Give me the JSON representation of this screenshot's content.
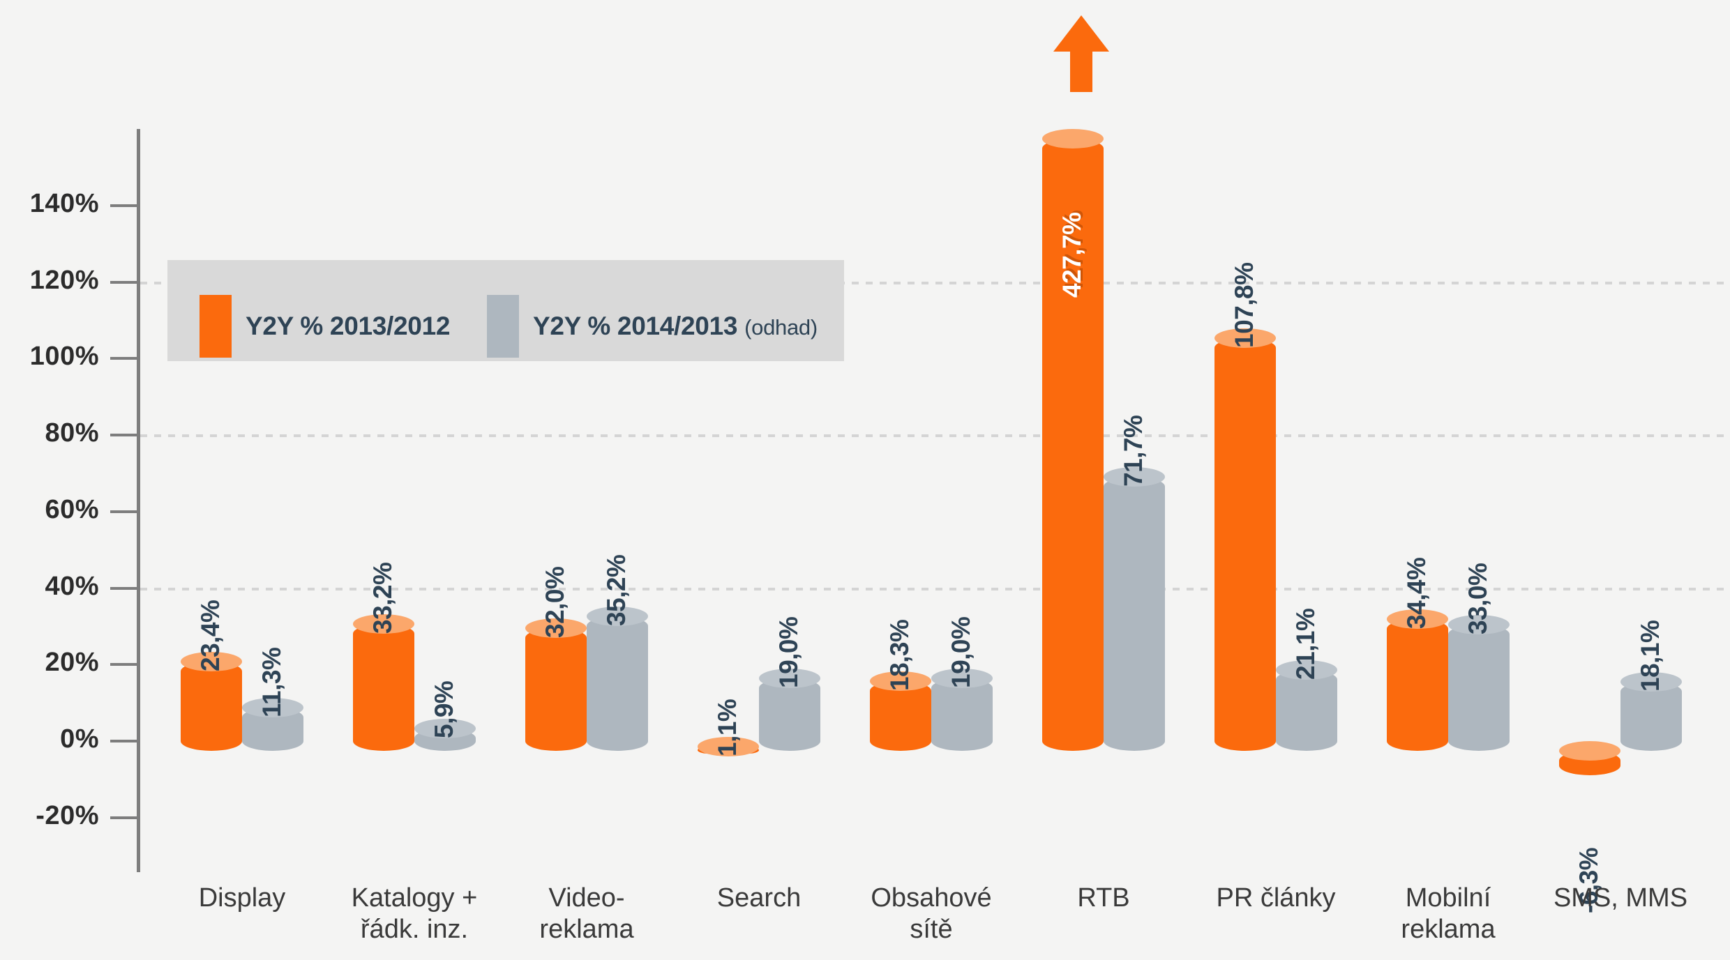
{
  "legend": {
    "series_1_label": "Y2Y % 2013/2012",
    "series_2_label": "Y2Y % 2014/2013",
    "series_2_note": "(odhad)",
    "series_1_color": "#fb6a0d",
    "series_2_color": "#aeb7bf"
  },
  "axis": {
    "y_ticks": [
      "140%",
      "120%",
      "100%",
      "80%",
      "60%",
      "40%",
      "20%",
      "0%",
      "-20%"
    ]
  },
  "chart_data": {
    "type": "bar",
    "title": "",
    "xlabel": "",
    "ylabel": "",
    "ylim": [
      -20,
      140
    ],
    "grid": true,
    "legend_position": "top-left",
    "categories": [
      "Display",
      "Katalogy +\nřádk. inz.",
      "Video-\nreklama",
      "Search",
      "Obsahové\nsítě",
      "RTB",
      "PR články",
      "Mobilní\nreklama",
      "SMS, MMS"
    ],
    "series": [
      {
        "name": "Y2Y % 2013/2012",
        "color": "#fb6a0d",
        "values": [
          23.4,
          33.2,
          32.0,
          1.1,
          18.3,
          427.7,
          107.8,
          34.4,
          -6.3
        ],
        "labels": [
          "23,4%",
          "33,2%",
          "32,0%",
          "1,1%",
          "18,3%",
          "427,7%",
          "107,8%",
          "34,4%",
          "-6,3%"
        ]
      },
      {
        "name": "Y2Y % 2014/2013 (odhad)",
        "color": "#aeb7bf",
        "values": [
          11.3,
          5.9,
          35.2,
          19.0,
          19.0,
          71.7,
          21.1,
          33.0,
          18.1
        ],
        "labels": [
          "11,3%",
          "5,9%",
          "35,2%",
          "19,0%",
          "19,0%",
          "71,7%",
          "21,1%",
          "33,0%",
          "18,1%"
        ]
      }
    ],
    "annotations": [
      {
        "name": "rtb-overflow-arrow",
        "category": "RTB",
        "series": "Y2Y % 2013/2012",
        "note": "value exceeds axis maximum"
      }
    ]
  }
}
